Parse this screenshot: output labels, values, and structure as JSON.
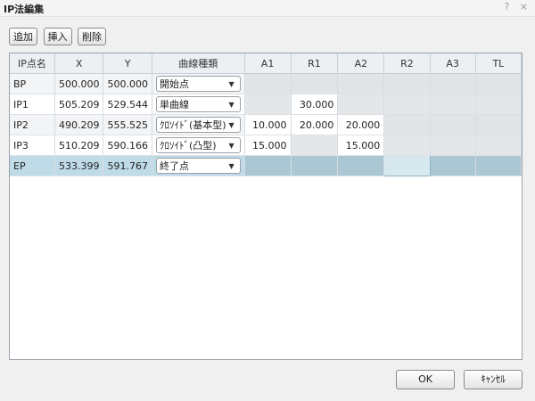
{
  "window": {
    "title": "IP法編集",
    "help_glyph": "?",
    "close_glyph": "⨯"
  },
  "toolbar": {
    "add_label": "追加",
    "insert_label": "挿入",
    "delete_label": "削除"
  },
  "grid": {
    "headers": [
      "IP点名",
      "X",
      "Y",
      "曲線種類",
      "A1",
      "R1",
      "A2",
      "R2",
      "A3",
      "TL"
    ],
    "rows": [
      {
        "name": "BP",
        "x": "500.000",
        "y": "500.000",
        "curve": "開始点",
        "a1": "",
        "r1": "",
        "a2": "",
        "r2": "",
        "a3": "",
        "tl": ""
      },
      {
        "name": "IP1",
        "x": "505.209",
        "y": "529.544",
        "curve": "単曲線",
        "a1": "",
        "r1": "30.000",
        "a2": "",
        "r2": "",
        "a3": "",
        "tl": ""
      },
      {
        "name": "IP2",
        "x": "490.209",
        "y": "555.525",
        "curve": "ｸﾛｿｲﾄﾞ(基本型)",
        "a1": "10.000",
        "r1": "20.000",
        "a2": "20.000",
        "r2": "",
        "a3": "",
        "tl": ""
      },
      {
        "name": "IP3",
        "x": "510.209",
        "y": "590.166",
        "curve": "ｸﾛｿｲﾄﾞ(凸型)",
        "a1": "15.000",
        "r1": "",
        "a2": "15.000",
        "r2": "",
        "a3": "",
        "tl": ""
      },
      {
        "name": "EP",
        "x": "533.399",
        "y": "591.767",
        "curve": "終了点",
        "a1": "",
        "r1": "",
        "a2": "",
        "r2": "",
        "a3": "",
        "tl": ""
      }
    ],
    "selected_row": 4
  },
  "footer": {
    "ok_label": "OK",
    "cancel_label": "ｷｬﾝｾﾙ"
  }
}
